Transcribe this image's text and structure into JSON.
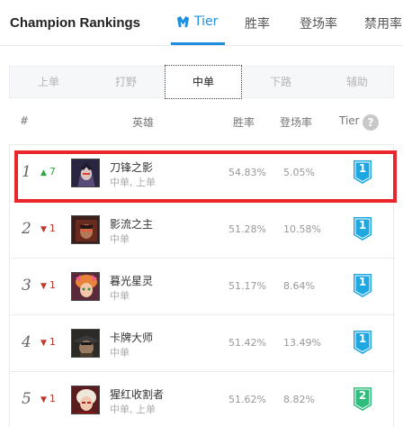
{
  "header": {
    "title": "Champion Rankings",
    "tabs": [
      {
        "label": "Tier",
        "active": true
      },
      {
        "label": "胜率"
      },
      {
        "label": "登场率"
      },
      {
        "label": "禁用率"
      }
    ]
  },
  "position_tabs": [
    "上单",
    "打野",
    "中单",
    "下路",
    "辅助"
  ],
  "selected_position": "中单",
  "columns": {
    "rank": "#",
    "champion": "英雄",
    "winrate": "胜率",
    "pickrate": "登场率",
    "tier": "Tier",
    "tier_help": "?"
  },
  "colors": {
    "accent": "#1e8fe0",
    "tier1": "#1ea7e1",
    "tier2": "#2ebd7c",
    "highlight": "#e8262b",
    "up": "#2aa641",
    "down": "#c0392b"
  },
  "rows": [
    {
      "rank": "1",
      "trend_dir": "up",
      "trend": "7",
      "name": "刀锋之影",
      "positions": "中单, 上单",
      "winrate": "54.83%",
      "pickrate": "5.05%",
      "tier": "1"
    },
    {
      "rank": "2",
      "trend_dir": "down",
      "trend": "1",
      "name": "影流之主",
      "positions": "中单",
      "winrate": "51.28%",
      "pickrate": "10.58%",
      "tier": "1"
    },
    {
      "rank": "3",
      "trend_dir": "down",
      "trend": "1",
      "name": "暮光星灵",
      "positions": "中单",
      "winrate": "51.17%",
      "pickrate": "8.64%",
      "tier": "1"
    },
    {
      "rank": "4",
      "trend_dir": "down",
      "trend": "1",
      "name": "卡牌大师",
      "positions": "中单",
      "winrate": "51.42%",
      "pickrate": "13.49%",
      "tier": "1"
    },
    {
      "rank": "5",
      "trend_dir": "down",
      "trend": "1",
      "name": "猩红收割者",
      "positions": "中单, 上单",
      "winrate": "51.62%",
      "pickrate": "8.82%",
      "tier": "2"
    }
  ],
  "icons": {
    "tier_logo": "tier-logo-icon",
    "help": "question-circle-icon",
    "up": "triangle-up-icon",
    "down": "triangle-down-icon"
  }
}
